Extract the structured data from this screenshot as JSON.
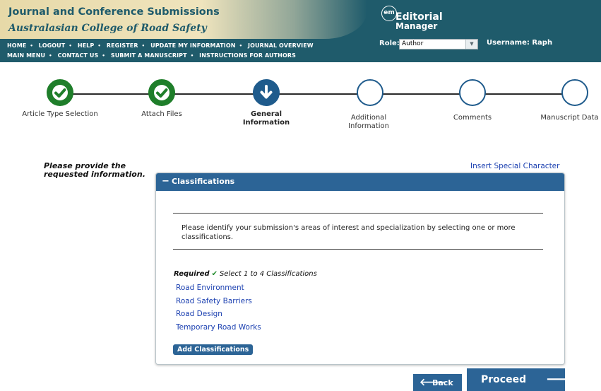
{
  "header": {
    "title": "Journal and Conference Submissions",
    "subtitle": "Australasian College of Road Safety",
    "nav_row_1": [
      "HOME",
      "LOGOUT",
      "HELP",
      "REGISTER",
      "UPDATE MY INFORMATION",
      "JOURNAL OVERVIEW"
    ],
    "nav_row_2": [
      "MAIN MENU",
      "CONTACT US",
      "SUBMIT A MANUSCRIPT",
      "INSTRUCTIONS FOR AUTHORS"
    ],
    "logo": {
      "badge": "em",
      "line1": "Editorial",
      "line2": "Manager"
    },
    "role_label": "Role:",
    "role_value": "Author",
    "username": "Username: Raph"
  },
  "steps": [
    {
      "label": "Article Type Selection",
      "state": "done",
      "icon": "check-icon"
    },
    {
      "label": "Attach Files",
      "state": "done",
      "icon": "check-icon"
    },
    {
      "label": "General Information",
      "state": "current",
      "icon": "arrow-down-icon"
    },
    {
      "label": "Additional Information",
      "state": "todo",
      "icon": ""
    },
    {
      "label": "Comments",
      "state": "todo",
      "icon": ""
    },
    {
      "label": "Manuscript Data",
      "state": "todo",
      "icon": ""
    }
  ],
  "prompt": "Please provide the requested information.",
  "special_char_link": "Insert Special Character",
  "panel": {
    "toggle": "−",
    "title": "Classifications",
    "instructions": "Please identify your submission's areas of interest and specialization by selecting one or more classifications.",
    "required_word": "Required",
    "required_check": "✔",
    "required_rule": "Select 1 to 4 Classifications",
    "classifications": [
      "Road Environment",
      "Road Safety Barriers",
      "Road Design",
      "Temporary Road Works"
    ],
    "add_button": "Add Classifications"
  },
  "footer": {
    "back_arrow": "🡐",
    "back": "Back",
    "proceed": "Proceed",
    "proceed_arrow": "🡒"
  },
  "colors": {
    "header_teal": "#1f5b6b",
    "header_gold": "#efe4bd",
    "accent_blue": "#2c6496",
    "done_green": "#1f7e2a",
    "link_blue": "#1a3fb0"
  }
}
